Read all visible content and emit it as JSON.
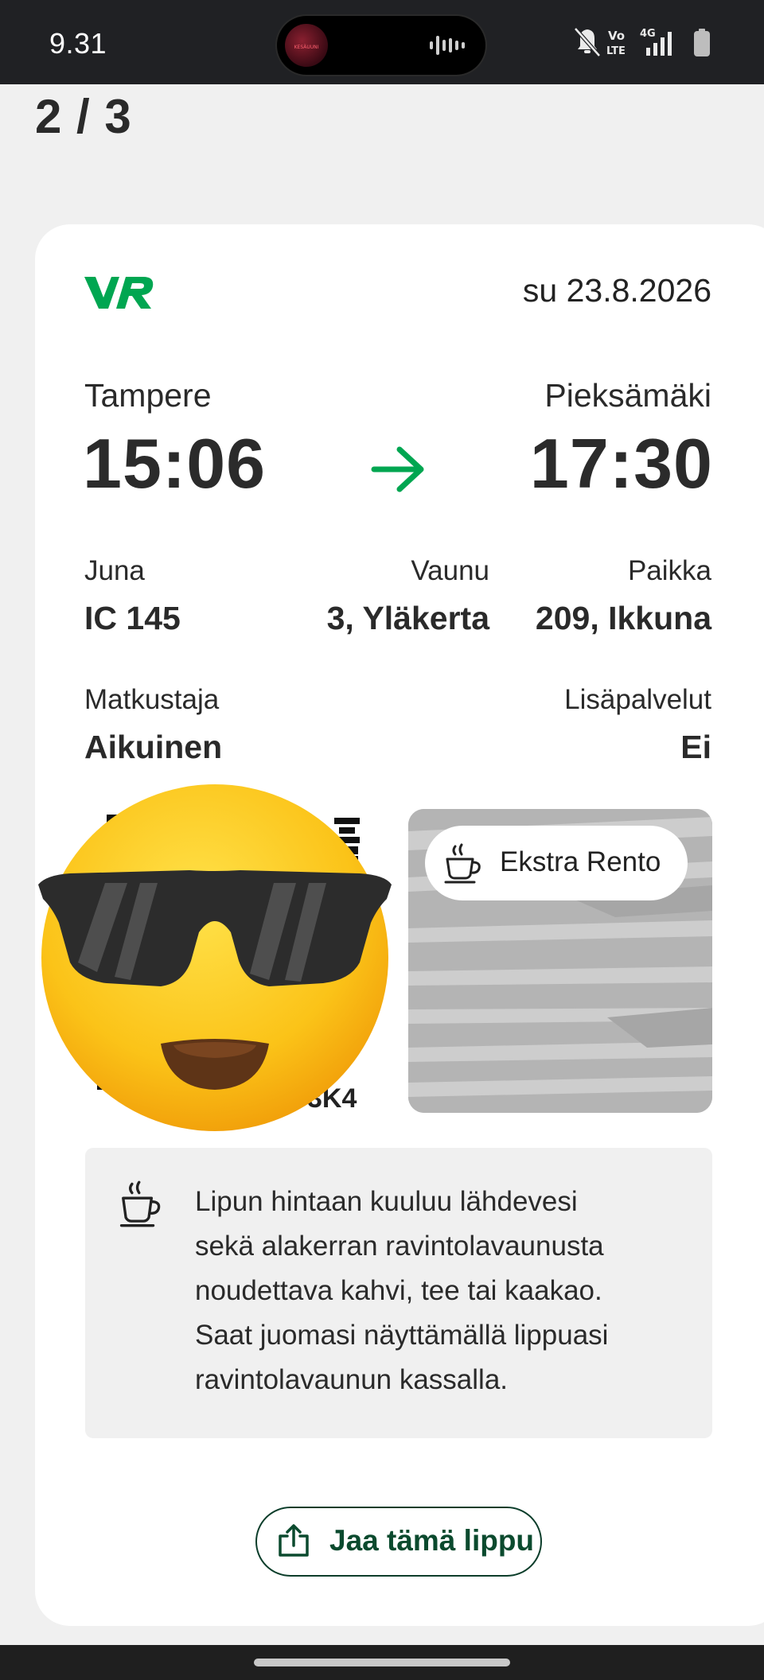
{
  "status_bar": {
    "time": "9.31",
    "island_label": "KESÄUUNI",
    "network_vo": "Vo",
    "network_lte": "LTE",
    "network_4g": "4G"
  },
  "page_indicator": "2 / 3",
  "ticket": {
    "operator_logo": "VR",
    "date": "su 23.8.2026",
    "from": {
      "station": "Tampere",
      "time": "15:06"
    },
    "to": {
      "station": "Pieksämäki",
      "time": "17:30"
    },
    "train": {
      "label": "Juna",
      "value": "IC 145"
    },
    "car": {
      "label": "Vaunu",
      "value": "3, Yläkerta"
    },
    "seat": {
      "label": "Paikka",
      "value": "209, Ikkuna"
    },
    "passenger": {
      "label": "Matkustaja",
      "value": "Aikuinen"
    },
    "extras": {
      "label": "Lisäpalvelut",
      "value": "Ei"
    },
    "code_visible": "3K4",
    "service_class": "Ekstra Rento",
    "info_lines": [
      "Lipun hintaan kuuluu lähdevesi",
      "sekä alakerran ravintolavaunusta",
      "noudettava kahvi, tee tai kaakao.",
      "Saat juomasi näyttämällä lippuasi",
      "ravintolavaunun kassalla."
    ],
    "share_button": "Jaa tämä lippu"
  },
  "colors": {
    "brand_green": "#00a651",
    "button_text": "#0b4a2e"
  },
  "icons": {
    "arrow": "arrow-right-icon",
    "coffee": "coffee-cup-icon",
    "share": "share-icon",
    "emoji": "sunglasses-emoji-sticker"
  }
}
